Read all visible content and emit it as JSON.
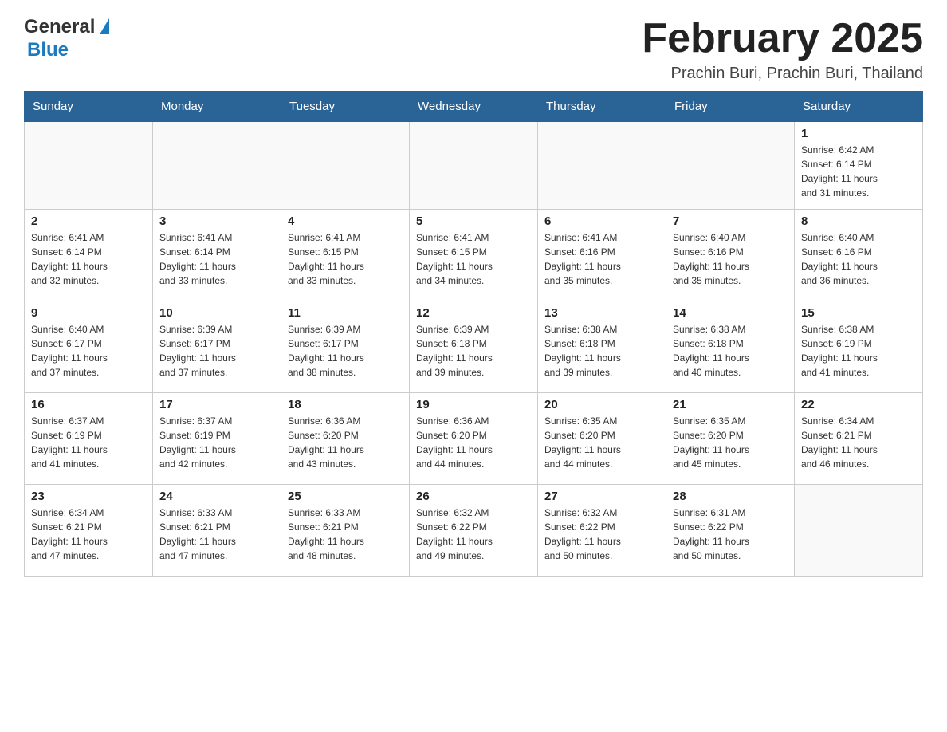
{
  "header": {
    "logo": {
      "general": "General",
      "blue": "Blue"
    },
    "title": "February 2025",
    "location": "Prachin Buri, Prachin Buri, Thailand"
  },
  "calendar": {
    "days_of_week": [
      "Sunday",
      "Monday",
      "Tuesday",
      "Wednesday",
      "Thursday",
      "Friday",
      "Saturday"
    ],
    "weeks": [
      [
        {
          "day": "",
          "info": ""
        },
        {
          "day": "",
          "info": ""
        },
        {
          "day": "",
          "info": ""
        },
        {
          "day": "",
          "info": ""
        },
        {
          "day": "",
          "info": ""
        },
        {
          "day": "",
          "info": ""
        },
        {
          "day": "1",
          "info": "Sunrise: 6:42 AM\nSunset: 6:14 PM\nDaylight: 11 hours\nand 31 minutes."
        }
      ],
      [
        {
          "day": "2",
          "info": "Sunrise: 6:41 AM\nSunset: 6:14 PM\nDaylight: 11 hours\nand 32 minutes."
        },
        {
          "day": "3",
          "info": "Sunrise: 6:41 AM\nSunset: 6:14 PM\nDaylight: 11 hours\nand 33 minutes."
        },
        {
          "day": "4",
          "info": "Sunrise: 6:41 AM\nSunset: 6:15 PM\nDaylight: 11 hours\nand 33 minutes."
        },
        {
          "day": "5",
          "info": "Sunrise: 6:41 AM\nSunset: 6:15 PM\nDaylight: 11 hours\nand 34 minutes."
        },
        {
          "day": "6",
          "info": "Sunrise: 6:41 AM\nSunset: 6:16 PM\nDaylight: 11 hours\nand 35 minutes."
        },
        {
          "day": "7",
          "info": "Sunrise: 6:40 AM\nSunset: 6:16 PM\nDaylight: 11 hours\nand 35 minutes."
        },
        {
          "day": "8",
          "info": "Sunrise: 6:40 AM\nSunset: 6:16 PM\nDaylight: 11 hours\nand 36 minutes."
        }
      ],
      [
        {
          "day": "9",
          "info": "Sunrise: 6:40 AM\nSunset: 6:17 PM\nDaylight: 11 hours\nand 37 minutes."
        },
        {
          "day": "10",
          "info": "Sunrise: 6:39 AM\nSunset: 6:17 PM\nDaylight: 11 hours\nand 37 minutes."
        },
        {
          "day": "11",
          "info": "Sunrise: 6:39 AM\nSunset: 6:17 PM\nDaylight: 11 hours\nand 38 minutes."
        },
        {
          "day": "12",
          "info": "Sunrise: 6:39 AM\nSunset: 6:18 PM\nDaylight: 11 hours\nand 39 minutes."
        },
        {
          "day": "13",
          "info": "Sunrise: 6:38 AM\nSunset: 6:18 PM\nDaylight: 11 hours\nand 39 minutes."
        },
        {
          "day": "14",
          "info": "Sunrise: 6:38 AM\nSunset: 6:18 PM\nDaylight: 11 hours\nand 40 minutes."
        },
        {
          "day": "15",
          "info": "Sunrise: 6:38 AM\nSunset: 6:19 PM\nDaylight: 11 hours\nand 41 minutes."
        }
      ],
      [
        {
          "day": "16",
          "info": "Sunrise: 6:37 AM\nSunset: 6:19 PM\nDaylight: 11 hours\nand 41 minutes."
        },
        {
          "day": "17",
          "info": "Sunrise: 6:37 AM\nSunset: 6:19 PM\nDaylight: 11 hours\nand 42 minutes."
        },
        {
          "day": "18",
          "info": "Sunrise: 6:36 AM\nSunset: 6:20 PM\nDaylight: 11 hours\nand 43 minutes."
        },
        {
          "day": "19",
          "info": "Sunrise: 6:36 AM\nSunset: 6:20 PM\nDaylight: 11 hours\nand 44 minutes."
        },
        {
          "day": "20",
          "info": "Sunrise: 6:35 AM\nSunset: 6:20 PM\nDaylight: 11 hours\nand 44 minutes."
        },
        {
          "day": "21",
          "info": "Sunrise: 6:35 AM\nSunset: 6:20 PM\nDaylight: 11 hours\nand 45 minutes."
        },
        {
          "day": "22",
          "info": "Sunrise: 6:34 AM\nSunset: 6:21 PM\nDaylight: 11 hours\nand 46 minutes."
        }
      ],
      [
        {
          "day": "23",
          "info": "Sunrise: 6:34 AM\nSunset: 6:21 PM\nDaylight: 11 hours\nand 47 minutes."
        },
        {
          "day": "24",
          "info": "Sunrise: 6:33 AM\nSunset: 6:21 PM\nDaylight: 11 hours\nand 47 minutes."
        },
        {
          "day": "25",
          "info": "Sunrise: 6:33 AM\nSunset: 6:21 PM\nDaylight: 11 hours\nand 48 minutes."
        },
        {
          "day": "26",
          "info": "Sunrise: 6:32 AM\nSunset: 6:22 PM\nDaylight: 11 hours\nand 49 minutes."
        },
        {
          "day": "27",
          "info": "Sunrise: 6:32 AM\nSunset: 6:22 PM\nDaylight: 11 hours\nand 50 minutes."
        },
        {
          "day": "28",
          "info": "Sunrise: 6:31 AM\nSunset: 6:22 PM\nDaylight: 11 hours\nand 50 minutes."
        },
        {
          "day": "",
          "info": ""
        }
      ]
    ]
  }
}
